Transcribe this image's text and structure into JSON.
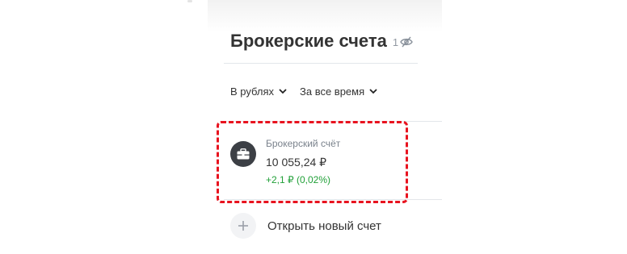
{
  "header": {
    "title": "Брокерские счета",
    "count": "1"
  },
  "filters": {
    "currency": "В рублях",
    "period": "За все время"
  },
  "account": {
    "name": "Брокерский счёт",
    "value": "10 055,24 ₽",
    "change": "+2,1 ₽ (0,02%)"
  },
  "actions": {
    "open_account": "Открыть новый счет"
  },
  "colors": {
    "gain": "#21a038",
    "highlight": "#e8131f",
    "icon_bg": "#3c3f45"
  },
  "icons": [
    "eye-off-icon",
    "chevron-down-icon",
    "briefcase-icon",
    "plus-icon"
  ]
}
